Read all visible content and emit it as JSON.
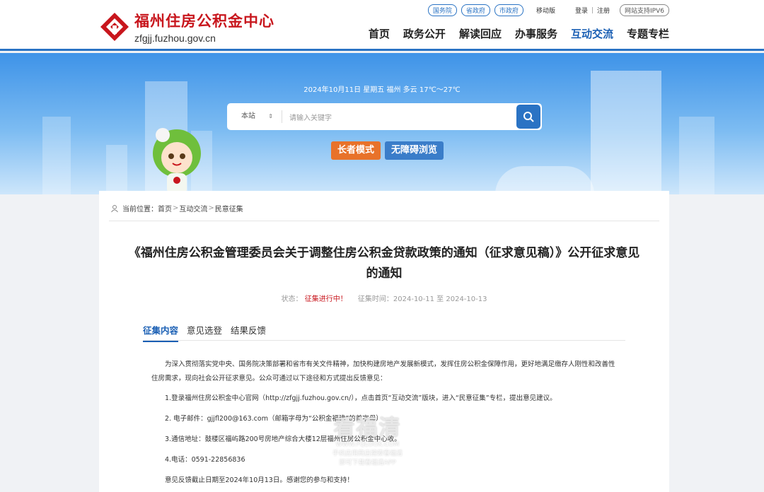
{
  "header": {
    "logo_cn": "福州住房公积金中心",
    "logo_en": "zfgjj.fuzhou.gov.cn",
    "gov_links": [
      "国务院",
      "省政府",
      "市政府"
    ],
    "mobile": "移动版",
    "login": "登录",
    "register": "注册",
    "ipv6": "网站支持IPV6",
    "nav": [
      "首页",
      "政务公开",
      "解读回应",
      "办事服务",
      "互动交流",
      "专题专栏"
    ],
    "brand_color": "#c8161d",
    "accent_color": "#1a5fb4"
  },
  "banner": {
    "weather": "2024年10月11日  星期五  福州  多云  17℃～27℃",
    "search_scope": "本站",
    "search_placeholder": "请输入关键字",
    "elder_mode": "长者模式",
    "accessible": "无障碍浏览"
  },
  "breadcrumb": {
    "prefix": "当前位置：",
    "items": [
      "首页",
      "互动交流",
      "民意征集"
    ]
  },
  "article": {
    "title": "《福州住房公积金管理委员会关于调整住房公积金贷款政策的通知（征求意见稿）》公开征求意见的通知",
    "status_label": "状态：",
    "status_value": "征集进行中！",
    "period": "征集时间：2024-10-11 至 2024-10-13",
    "tabs": [
      "征集内容",
      "意见选登",
      "结果反馈"
    ],
    "paragraphs": [
      "为深入贯彻落实党中央、国务院决策部署和省市有关文件精神，加快构建房地产发展新模式，发挥住房公积金保障作用，更好地满足缴存人刚性和改善性住房需求，现向社会公开征求意见。公众可通过以下途径和方式提出反馈意见：",
      "1.登录福州住房公积金中心官网（http://zfgjj.fuzhou.gov.cn/），点击首页“互动交流”版块，进入“民意征集”专栏，提出意见建议。",
      "2. 电子邮件：gjjfl200@163.com（邮箱字母为“公积金福建”的首字母）",
      "3.通信地址：鼓楼区福屿路200号房地产综合大楼12层福州住房公积金中心收。",
      "4.电话：0591-22856836",
      "意见反馈截止日期至2024年10月13日。感谢您的参与和支持！"
    ]
  },
  "watermark": {
    "big": "看福清",
    "site": "WWW.FQLOOK.COM",
    "line1": "手机应用商店搜索看福清",
    "line2": "即可下载看福清APP"
  }
}
